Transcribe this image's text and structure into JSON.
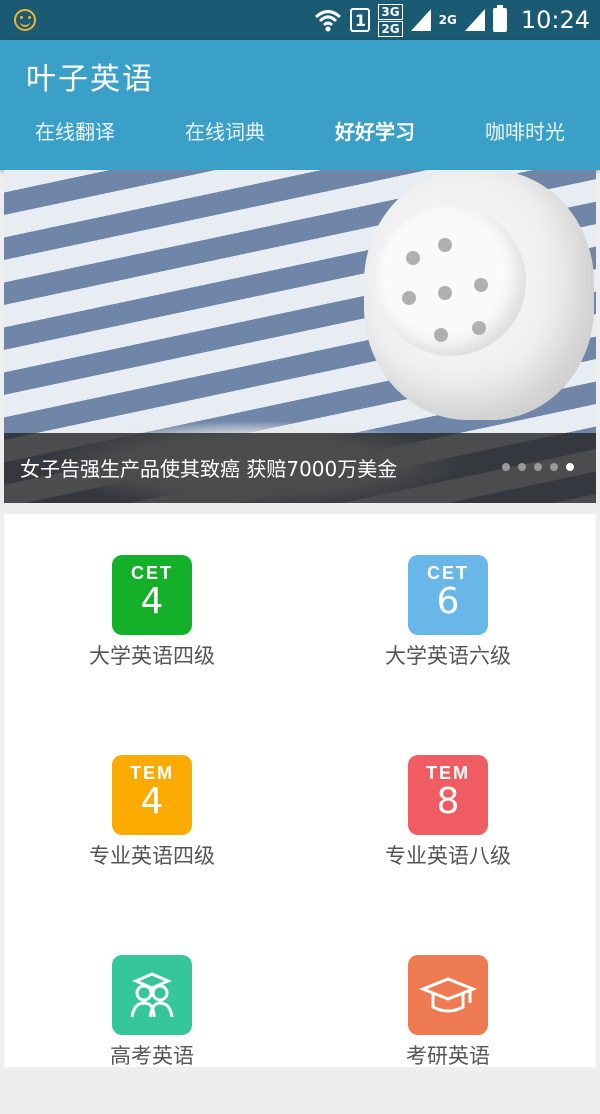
{
  "status_bar": {
    "time": "10:24",
    "sim_slot": "1",
    "network_primary": "3G",
    "network_secondary": "2G",
    "network_third": "2G"
  },
  "app": {
    "title": "叶子英语"
  },
  "tabs": [
    {
      "label": "在线翻译"
    },
    {
      "label": "在线词典"
    },
    {
      "label": "好好学习"
    },
    {
      "label": "咖啡时光"
    }
  ],
  "banner": {
    "caption": "女子告强生产品使其致癌 获赔7000万美金",
    "page_count": 5,
    "active_page": 5
  },
  "items": [
    {
      "title": "大学英语四级",
      "badge_top": "CET",
      "badge_num": "4",
      "color": "#14b029"
    },
    {
      "title": "大学英语六级",
      "badge_top": "CET",
      "badge_num": "6",
      "color": "#68b7e8"
    },
    {
      "title": "专业英语四级",
      "badge_top": "TEM",
      "badge_num": "4",
      "color": "#fbaa00"
    },
    {
      "title": "专业英语八级",
      "badge_top": "TEM",
      "badge_num": "8",
      "color": "#ef5d62"
    },
    {
      "title": "高考英语",
      "icon": "students-icon",
      "color": "#35c69a"
    },
    {
      "title": "考研英语",
      "icon": "graduation-cap-icon",
      "color": "#ee7a52"
    }
  ],
  "colors": {
    "status_bar": "#1a5a73",
    "app_bar": "#3aa0c8"
  }
}
